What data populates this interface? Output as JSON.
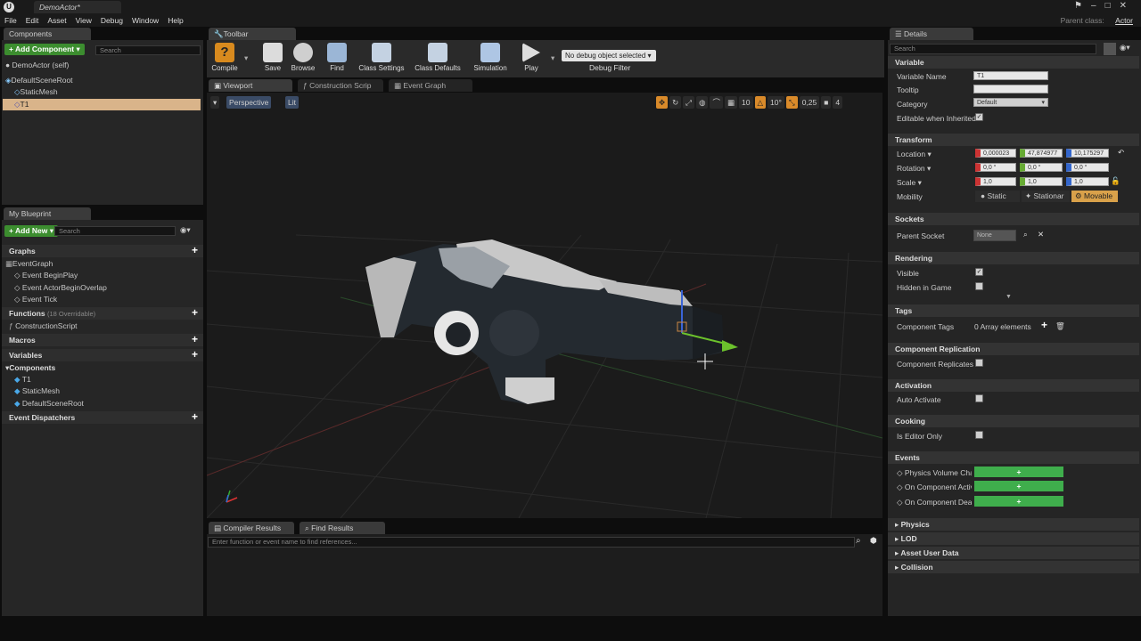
{
  "window": {
    "title": "DemoActor*",
    "parent_class_label": "Parent class:",
    "parent_class_value": "Actor"
  },
  "menu": [
    "File",
    "Edit",
    "Asset",
    "View",
    "Debug",
    "Window",
    "Help"
  ],
  "components_panel": {
    "tab": "Components",
    "add_label": "+ Add Component ▾",
    "search_placeholder": "Search",
    "self": "DemoActor (self)",
    "tree": [
      "DefaultSceneRoot",
      "StaticMesh",
      "T1"
    ]
  },
  "toolbar": {
    "tab": "Toolbar",
    "buttons": [
      "Compile",
      "Save",
      "Browse",
      "Find",
      "Class Settings",
      "Class Defaults",
      "Simulation",
      "Play"
    ],
    "debug_select": "No debug object selected ▾",
    "debug_filter": "Debug Filter"
  },
  "editor_tabs": {
    "viewport": "Viewport",
    "construction": "Construction Scrip",
    "event_graph": "Event Graph"
  },
  "viewport": {
    "perspective": "Perspective",
    "lit": "Lit",
    "grid_snap": "10",
    "rot_snap": "10°",
    "scale_snap": "0,25",
    "cam_speed": "4"
  },
  "my_blueprint": {
    "tab": "My Blueprint",
    "add_new": "+ Add New ▾",
    "search_placeholder": "Search",
    "sections": {
      "graphs": "Graphs",
      "functions": "Functions",
      "functions_count": "(18 Overridable)",
      "macros": "Macros",
      "variables": "Variables",
      "components": "Components",
      "dispatchers": "Event Dispatchers"
    },
    "graph_items": [
      "EventGraph",
      "Event BeginPlay",
      "Event ActorBeginOverlap",
      "Event Tick"
    ],
    "function_items": [
      "ConstructionScript"
    ],
    "component_items": [
      "T1",
      "StaticMesh",
      "DefaultSceneRoot"
    ]
  },
  "bottom": {
    "compiler_tab": "Compiler Results",
    "find_tab": "Find Results",
    "find_placeholder": "Enter function or event name to find references..."
  },
  "details": {
    "tab": "Details",
    "search_placeholder": "Search",
    "variable": {
      "header": "Variable",
      "name_label": "Variable Name",
      "name_value": "T1",
      "tooltip_label": "Tooltip",
      "category_label": "Category",
      "category_value": "Default",
      "editable_label": "Editable when Inherited"
    },
    "transform": {
      "header": "Transform",
      "location": "Location ▾",
      "rotation": "Rotation ▾",
      "scale": "Scale ▾",
      "mobility": "Mobility",
      "loc": [
        "0,000023",
        "47,874977",
        "10,175297"
      ],
      "rot": [
        "0,0 °",
        "0,0 °",
        "0,0 °"
      ],
      "scl": [
        "1,0",
        "1,0",
        "1,0"
      ],
      "static": "Static",
      "stationary": "Stationar",
      "movable": "Movable"
    },
    "sockets": {
      "header": "Sockets",
      "parent_label": "Parent Socket",
      "parent_value": "None"
    },
    "rendering": {
      "header": "Rendering",
      "visible": "Visible",
      "hidden": "Hidden in Game"
    },
    "tags": {
      "header": "Tags",
      "label": "Component Tags",
      "value": "0 Array elements"
    },
    "replication": {
      "header": "Component Replication",
      "label": "Component Replicates"
    },
    "activation": {
      "header": "Activation",
      "label": "Auto Activate"
    },
    "cooking": {
      "header": "Cooking",
      "label": "Is Editor Only"
    },
    "events": {
      "header": "Events",
      "items": [
        "Physics Volume Cha",
        "On Component Activ",
        "On Component Deac"
      ]
    },
    "collapsed": [
      "Physics",
      "LOD",
      "Asset User Data",
      "Collision"
    ]
  },
  "colors": {
    "accent_orange": "#d9a14a",
    "green": "#3c8d2f",
    "selection": "#d9b48a"
  }
}
